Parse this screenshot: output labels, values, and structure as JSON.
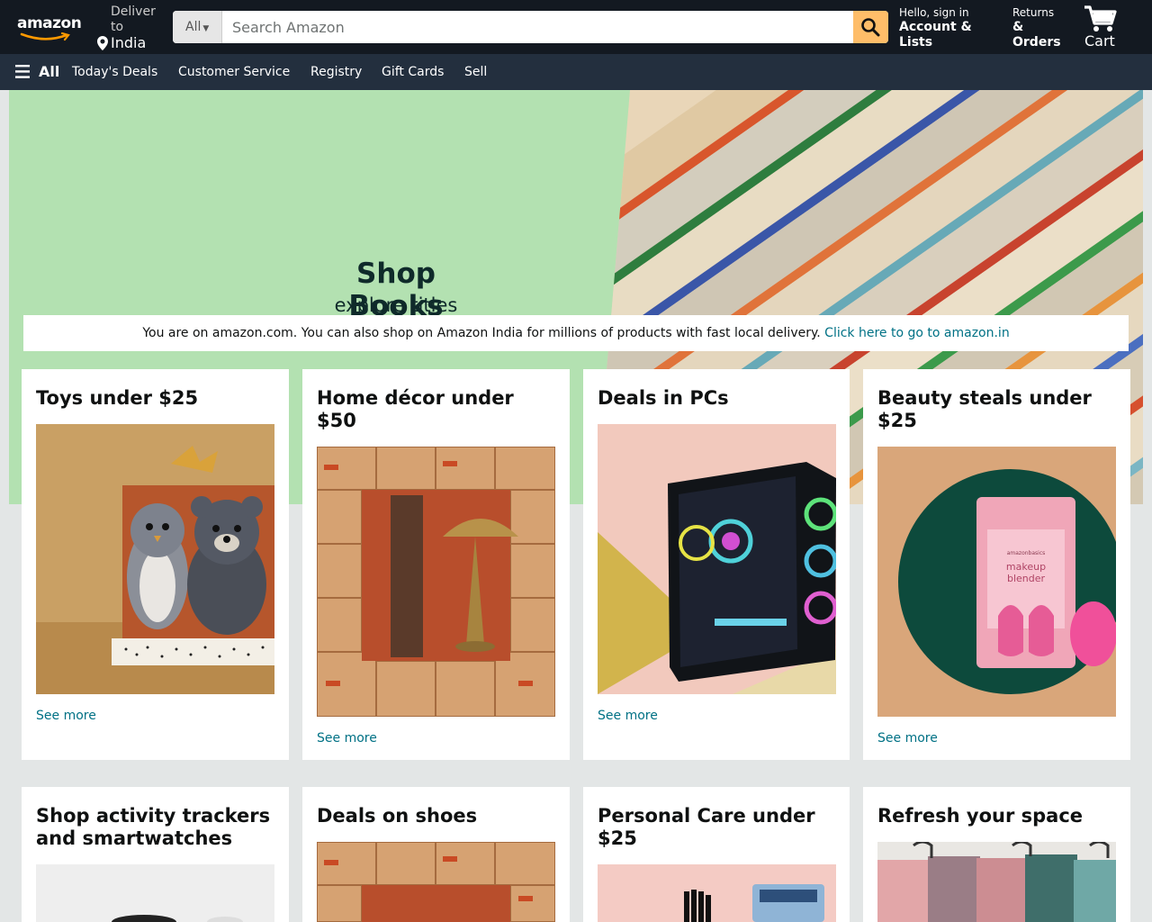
{
  "header": {
    "logo_text": "amazon",
    "deliver_line1": "Deliver to",
    "deliver_location": "India",
    "search_category": "All",
    "search_placeholder": "Search Amazon",
    "account_line1": "Hello, sign in",
    "account_line2": "Account & Lists",
    "returns_line1": "Returns",
    "returns_line2": "& Orders",
    "cart_label": "Cart"
  },
  "subnav": {
    "all_label": "All",
    "items": [
      "Today's Deals",
      "Customer Service",
      "Registry",
      "Gift Cards",
      "Sell"
    ]
  },
  "hero": {
    "title": "Shop Books",
    "subtitle": "explore titles"
  },
  "notice": {
    "text": "You are on amazon.com. You can also shop on Amazon India for millions of products with fast local delivery.",
    "link_text": "Click here to go to amazon.in"
  },
  "cards": [
    {
      "title": "Toys under $25",
      "see_more": "See more"
    },
    {
      "title": "Home décor under $50",
      "see_more": "See more"
    },
    {
      "title": "Deals in PCs",
      "see_more": "See more"
    },
    {
      "title": "Beauty steals under $25",
      "see_more": "See more"
    },
    {
      "title": "Shop activity trackers and smartwatches"
    },
    {
      "title": "Deals on shoes"
    },
    {
      "title": "Personal Care under $25"
    },
    {
      "title": "Refresh your space"
    }
  ],
  "product_image_text": {
    "brand": "amazon",
    "makeup_brand": "amazonbasics",
    "makeup_line1": "makeup",
    "makeup_line2": "blender"
  },
  "colors": {
    "nav_bg": "#131921",
    "subnav_bg": "#232f3e",
    "search_button": "#febd69",
    "hero_green": "#b3e1b1",
    "link": "#007185",
    "page_bg": "#e3e6e6"
  },
  "icons": [
    "amazon-smile-icon",
    "location-pin-icon",
    "caret-down-icon",
    "search-icon",
    "cart-icon",
    "hamburger-icon"
  ]
}
